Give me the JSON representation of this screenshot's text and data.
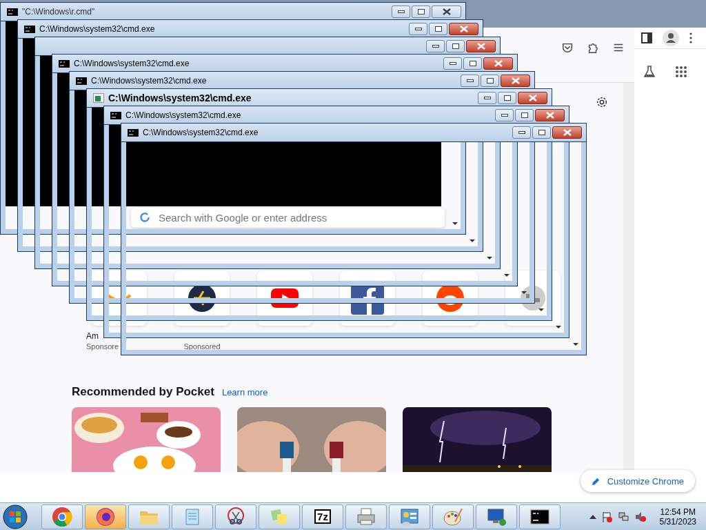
{
  "windows": [
    {
      "title": "\"C:\\Windows\\r.cmd\"",
      "inactive": true,
      "focused": false
    },
    {
      "title": "C:\\Windows\\system32\\cmd.exe",
      "inactive": false,
      "focused": false
    },
    {
      "inactive": false
    },
    {
      "title": "C:\\Windows\\system32\\cmd.exe",
      "inactive": false,
      "focused": false
    },
    {
      "title": "C:\\Windows\\system32\\cmd.exe",
      "inactive": false,
      "focused": false
    },
    {
      "title": "C:\\Windows\\system32\\cmd.exe",
      "inactive": false,
      "focused": true
    },
    {
      "title": "C:\\Windows\\system32\\cmd.exe",
      "inactive": false,
      "focused": false
    },
    {
      "title": "C:\\Windows\\system32\\cmd.exe",
      "inactive": false,
      "focused": false
    }
  ],
  "search": {
    "placeholder": "Search with Google or enter address"
  },
  "top_sites": [
    {
      "kind": "smile",
      "label": "Am",
      "sublabel": "Sponsore"
    },
    {
      "kind": "plane",
      "sublabel": "Sponsored"
    },
    {
      "kind": "play"
    },
    {
      "kind": "square"
    },
    {
      "kind": "robot"
    },
    {
      "kind": "globe"
    }
  ],
  "pocket": {
    "heading": "Recommended by Pocket",
    "link": "Learn more"
  },
  "customize_button": "Customize Chrome",
  "taskbar": {
    "apps": [
      {
        "kind": "chrome"
      },
      {
        "kind": "firefox"
      },
      {
        "kind": "folder"
      },
      {
        "kind": "notepad"
      },
      {
        "kind": "scissors"
      },
      {
        "kind": "notes"
      },
      {
        "kind": "archive",
        "label": "7z"
      },
      {
        "kind": "printer"
      },
      {
        "kind": "panel"
      },
      {
        "kind": "palette"
      },
      {
        "kind": "remote"
      },
      {
        "kind": "console"
      }
    ]
  },
  "clock": {
    "time": "12:54 PM",
    "date": "5/31/2023"
  }
}
